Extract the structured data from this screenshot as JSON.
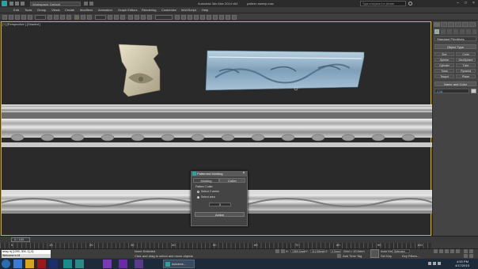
{
  "titlebar": {
    "workspace": "Workspace: Default",
    "app_title": "Autodesk 3ds Max 2014 x64",
    "file_name": "pattern sweep.max",
    "search_placeholder": "Type a keyword or phrase"
  },
  "menu": {
    "items": [
      "Edit",
      "Tools",
      "Group",
      "Views",
      "Create",
      "Modifiers",
      "Animation",
      "Graph Editors",
      "Rendering",
      "Customize",
      "MAXScript",
      "Help"
    ]
  },
  "viewport": {
    "label": "[+] [Perspective ] [Shaded ]"
  },
  "command_panel": {
    "dropdown": "Standard Primitives",
    "object_type_label": "Object Type",
    "buttons": [
      "Box",
      "Cone",
      "Sphere",
      "GeoSphere",
      "Cylinder",
      "Tube",
      "Torus",
      "Pyramid",
      "Teapot",
      "Plane"
    ],
    "name_color_label": "Name and Color",
    "name_value": "C16"
  },
  "dialog": {
    "title": "Patterned Molding",
    "tab1": "Molding",
    "tab2": "Cutter",
    "section": "Pattern Cutter",
    "option1": "Select 2 vertex",
    "option2": "Select area",
    "value": "0",
    "action": "Action"
  },
  "timeline": {
    "frame": "0 / 100",
    "ticks": [
      "0",
      "10",
      "20",
      "30",
      "40",
      "50",
      "60",
      "70",
      "80",
      "90",
      "100"
    ]
  },
  "status": {
    "selection": "None Selected",
    "prompt": "Click and drag to select and move objects",
    "coords_label": "Welcome to M",
    "x": "1369.0mm",
    "y": "112.65mm",
    "z": "0.0mm",
    "grid": "Grid = 10.0mm",
    "auto_key": "Auto Key",
    "selected": "Selected",
    "set_key": "Set Key",
    "key_filters": "Key Filters...",
    "add_time_tag": "Add Time Tag",
    "maxscript_line": "array #( [1290,.304,.1],.0]"
  },
  "taskbar": {
    "time": "4:53 PM",
    "date": "4/17/2015",
    "app_label": "Autodesk..."
  }
}
